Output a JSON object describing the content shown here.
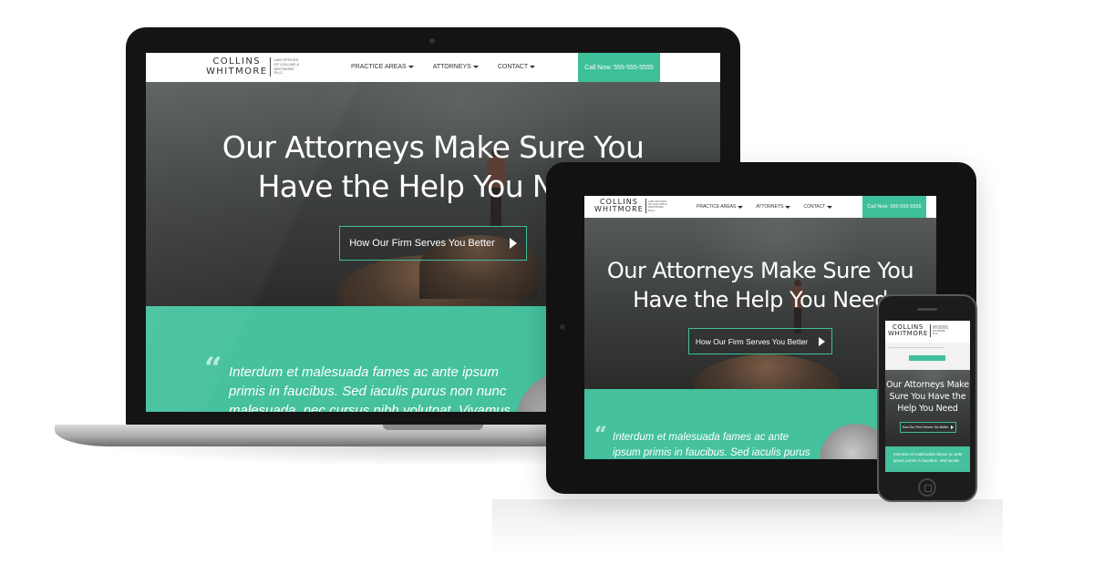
{
  "brand": {
    "name_line1": "COLLINS",
    "name_line2": "WHITMORE",
    "sub_line1": "LAW OFFICES",
    "sub_line2": "OF COLLINS &",
    "sub_line3": "WHITMORE",
    "sub_line4": "PLLC"
  },
  "nav": {
    "practice_areas": "PRACTICE AREAS",
    "attorneys": "ATTORNEYS",
    "contact": "CONTACT"
  },
  "call_button": "Call Now: 555-555-5555",
  "hero": {
    "title_line1": "Our Attorneys Make Sure You",
    "title_line2": "Have the Help You Need",
    "button_label": "How Our Firm Serves You Better"
  },
  "phone_hero": {
    "line1": "Our Attorneys Make",
    "line2": "Sure You Have the",
    "line3": "Help You Need"
  },
  "testimonial": {
    "quote_mark": "“",
    "laptop_line1": "Interdum et malesuada fames ac ante ipsum",
    "laptop_line2": "primis in faucibus. Sed iaculis purus non nunc",
    "laptop_line3": "malesuada, nec cursus nibh volutpat. Vivamus",
    "tablet_line1": "Interdum et malesuada fames ac ante",
    "tablet_line2": "ipsum primis in faucibus. Sed iaculis purus",
    "phone_line1": "Interdum et malesuada fames ac ante",
    "phone_line2": "ipsum primis in faucibus. Sed iaculis"
  },
  "colors": {
    "accent": "#3fbf9a",
    "testimonial_bg": "#45c19d",
    "device_frame": "#141414"
  },
  "icons": {
    "menu_caret": "caret-down-icon",
    "button_arrow": "play-arrow-icon",
    "quote": "quote-icon"
  }
}
